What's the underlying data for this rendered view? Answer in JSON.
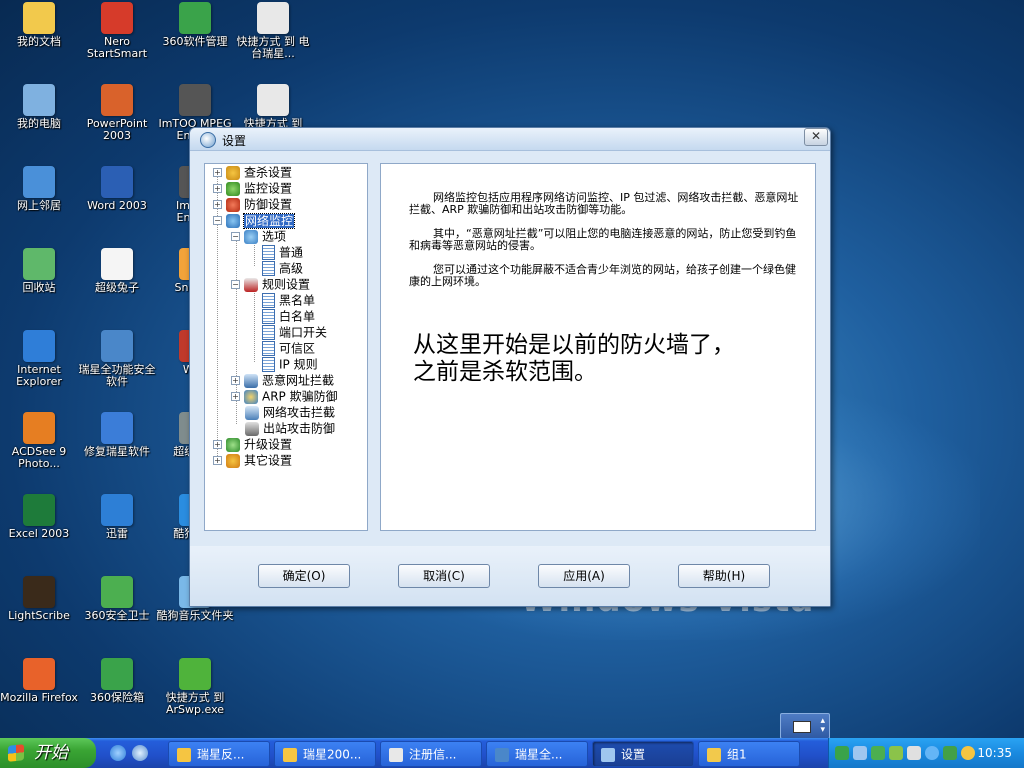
{
  "desktop": {
    "icons": [
      {
        "label": "我的文档",
        "icon": "my-documents-icon",
        "color": "#f2c94c"
      },
      {
        "label": "Nero StartSmart",
        "icon": "nero-icon",
        "color": "#d63b2a"
      },
      {
        "label": "360软件管理",
        "icon": "360-software-manager-icon",
        "color": "#3aa34a"
      },
      {
        "label": "快捷方式 到 电台瑞星...",
        "icon": "shortcut-doc-icon",
        "color": "#e8e8e8"
      },
      {
        "label": "我的电脑",
        "icon": "my-computer-icon",
        "color": "#7fb1e0"
      },
      {
        "label": "PowerPoint 2003",
        "icon": "powerpoint-icon",
        "color": "#d9622b"
      },
      {
        "label": "ImTOO MPEG Enco...",
        "icon": "imtoo-icon",
        "color": "#555555"
      },
      {
        "label": "快捷方式 到",
        "icon": "shortcut-doc-icon",
        "color": "#e8e8e8"
      },
      {
        "label": "网上邻居",
        "icon": "network-places-icon",
        "color": "#4a90d9"
      },
      {
        "label": "Word 2003",
        "icon": "word-icon",
        "color": "#2b5fb4"
      },
      {
        "label": "ImTOO Enco...",
        "icon": "imtoo-icon",
        "color": "#555555"
      },
      {
        "label": "回收站",
        "icon": "recycle-bin-icon",
        "color": "#5fb86a"
      },
      {
        "label": "超级兔子",
        "icon": "super-rabbit-icon",
        "color": "#f5f5f5"
      },
      {
        "label": "SndM...",
        "icon": "sndm-icon",
        "color": "#f2a33a"
      },
      {
        "label": "Internet Explorer",
        "icon": "ie-icon",
        "color": "#2f7ed8"
      },
      {
        "label": "瑞星全功能安全软件",
        "icon": "rising-security-icon",
        "color": "#4a87c9"
      },
      {
        "label": "Wi...",
        "icon": "wi-icon",
        "color": "#c0392b"
      },
      {
        "label": "ACDSee 9 Photo...",
        "icon": "acdsee-icon",
        "color": "#e67e22"
      },
      {
        "label": "修复瑞星软件",
        "icon": "repair-rising-icon",
        "color": "#3b7dd8"
      },
      {
        "label": "超级解...",
        "icon": "super-tool-icon",
        "color": "#7f8c8d"
      },
      {
        "label": "Excel 2003",
        "icon": "excel-icon",
        "color": "#1e7b3a"
      },
      {
        "label": "迅雷",
        "icon": "thunder-icon",
        "color": "#2d7fd6"
      },
      {
        "label": "酷狗音...",
        "icon": "kugou-icon",
        "color": "#2a8de0"
      },
      {
        "label": "LightScribe",
        "icon": "lightscribe-icon",
        "color": "#3a2a1a"
      },
      {
        "label": "360安全卫士",
        "icon": "360-safe-icon",
        "color": "#4caf50"
      },
      {
        "label": "酷狗音乐文件夹",
        "icon": "kugou-folder-icon",
        "color": "#7ab8e8"
      },
      {
        "label": "Mozilla Firefox",
        "icon": "firefox-icon",
        "color": "#e8622a"
      },
      {
        "label": "360保险箱",
        "icon": "360-safebox-icon",
        "color": "#3aa34a"
      },
      {
        "label": "快捷方式 到 ArSwp.exe",
        "icon": "arswp-icon",
        "color": "#4fb33b"
      }
    ],
    "wallpaper_text": "Windows Vista"
  },
  "dialog": {
    "title": "设置",
    "close_label": "✕",
    "tree": {
      "scan": "查杀设置",
      "monitor": "监控设置",
      "defense": "防御设置",
      "network_monitor": "网络监控",
      "options": "选项",
      "normal": "普通",
      "advanced": "高级",
      "rules": "规则设置",
      "blacklist": "黑名单",
      "whitelist": "白名单",
      "port_switch": "端口开关",
      "trusted_zone": "可信区",
      "ip_rules": "IP 规则",
      "malicious_url": "恶意网址拦截",
      "arp_defense": "ARP 欺骗防御",
      "net_attack": "网络攻击拦截",
      "outbound_attack": "出站攻击防御",
      "upgrade": "升级设置",
      "other": "其它设置"
    },
    "content": {
      "para1": "网络监控包括应用程序网络访问监控、IP 包过滤、网络攻击拦截、恶意网址拦截、ARP 欺骗防御和出站攻击防御等功能。",
      "para2": "其中，“恶意网址拦截”可以阻止您的电脑连接恶意的网站，防止您受到钓鱼和病毒等恶意网站的侵害。",
      "para3": "您可以通过这个功能屏蔽不适合青少年浏览的网站，给孩子创建一个绿色健康的上网环境。",
      "note": "从这里开始是以前的防火墙了，之前是杀软范围。"
    },
    "buttons": {
      "ok": "确定(O)",
      "cancel": "取消(C)",
      "apply": "应用(A)",
      "help": "帮助(H)"
    }
  },
  "taskbar": {
    "start_label": "开始",
    "tasks": [
      {
        "label": "瑞星反...",
        "icon": "rising-icon"
      },
      {
        "label": "瑞星200...",
        "icon": "rising-icon"
      },
      {
        "label": "注册信...",
        "icon": "document-icon"
      },
      {
        "label": "瑞星全...",
        "icon": "rising-security-icon"
      },
      {
        "label": "设置",
        "icon": "settings-icon"
      },
      {
        "label": "组1",
        "icon": "folder-icon"
      }
    ],
    "clock": "10:35"
  },
  "colors": {
    "taskbar_blue": "#245edb",
    "start_green": "#3aa534",
    "selection_blue": "#316ac5"
  }
}
